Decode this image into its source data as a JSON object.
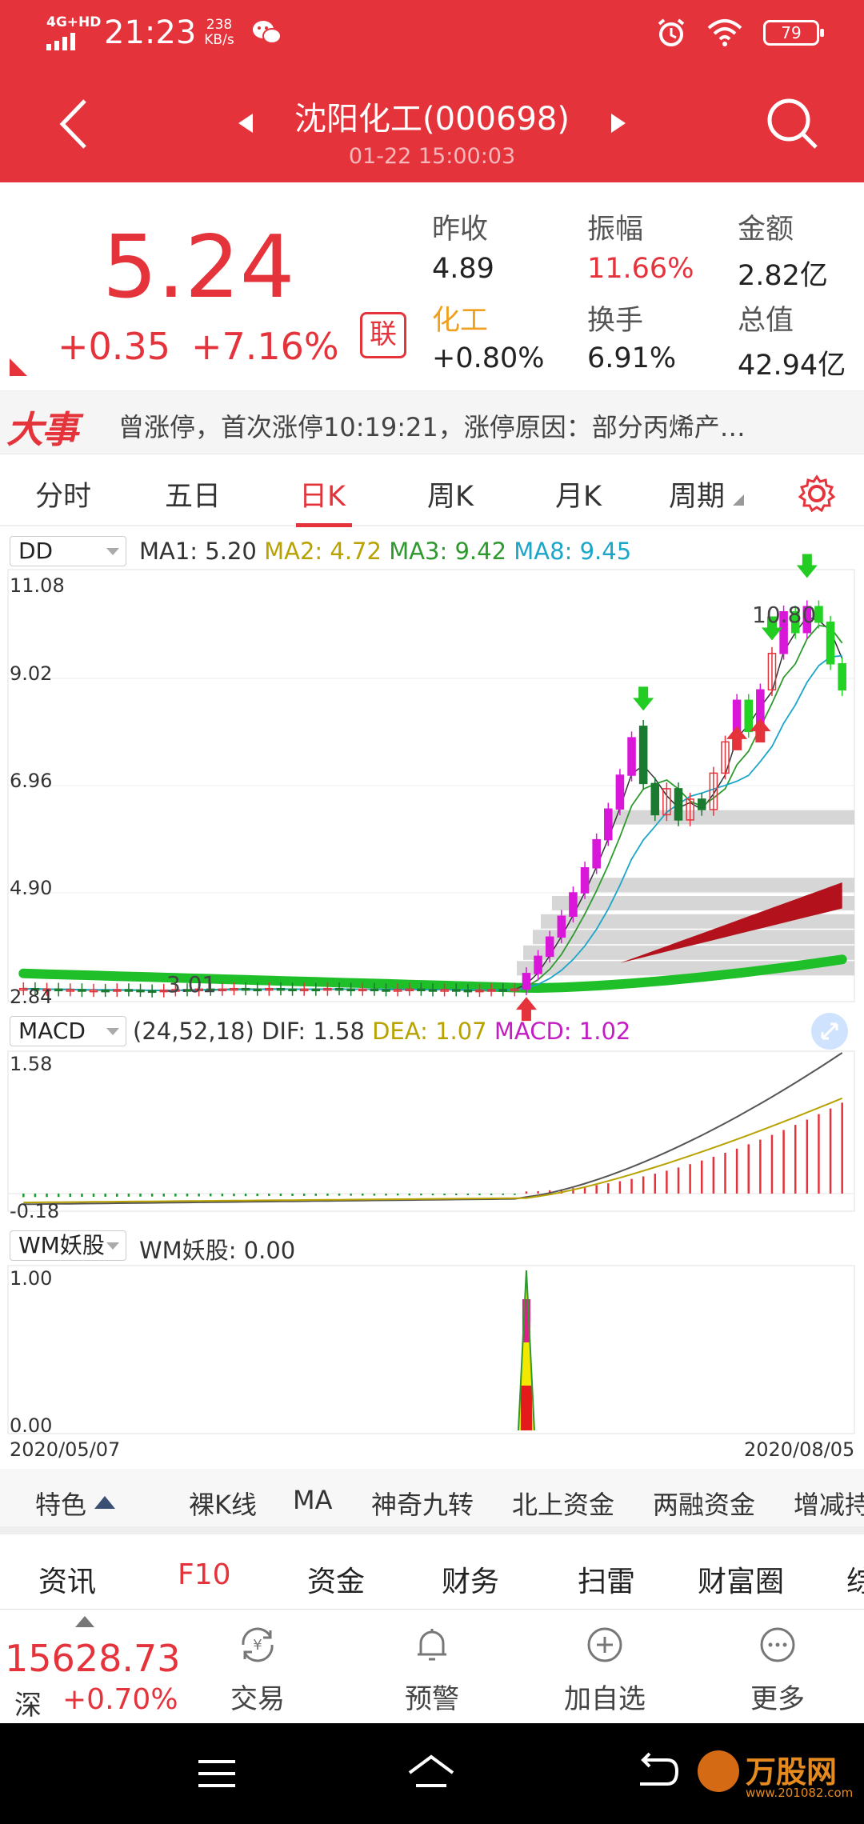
{
  "status_bar": {
    "network": "4G+HD",
    "time": "21:23",
    "speed_value": "238",
    "speed_unit": "KB/s",
    "battery": "79"
  },
  "header": {
    "stock_name": "沈阳化工(000698)",
    "timestamp": "01-22 15:00:03"
  },
  "quote": {
    "price": "5.24",
    "change": "+0.35",
    "change_pct": "+7.16%",
    "lian_label": "联",
    "prev_close_label": "昨收",
    "prev_close": "4.89",
    "amplitude_label": "振幅",
    "amplitude": "11.66%",
    "amount_label": "金额",
    "amount": "2.82亿",
    "sector_label": "化工",
    "sector_change": "+0.80%",
    "turnover_label": "换手",
    "turnover": "6.91%",
    "market_cap_label": "总值",
    "market_cap": "42.94亿"
  },
  "news": {
    "logo": "大事",
    "text": "曾涨停，首次涨停10:19:21，涨停原因：部分丙烯产…"
  },
  "period_tabs": [
    {
      "label": "分时"
    },
    {
      "label": "五日"
    },
    {
      "label": "日K"
    },
    {
      "label": "周K"
    },
    {
      "label": "月K"
    },
    {
      "label": "周期"
    }
  ],
  "kline": {
    "indicator": "DD",
    "ma1": "MA1: 5.20",
    "ma2": "MA2: 4.72",
    "ma3": "MA3: 9.42",
    "ma8": "MA8: 9.45",
    "y_max": "11.08",
    "y_2": "9.02",
    "y_3": "6.96",
    "y_4": "4.90",
    "y_min": "2.84",
    "low_mark": "3.01",
    "high_mark": "10.80"
  },
  "macd": {
    "indicator": "MACD",
    "params": "(24,52,18)",
    "dif": "DIF: 1.58",
    "dea": "DEA: 1.07",
    "macd": "MACD: 1.02",
    "y_max": "1.58",
    "y_min": "-0.18"
  },
  "wm": {
    "indicator": "WM妖股",
    "value": "WM妖股: 0.00",
    "y_max": "1.00",
    "y_min": "0.00",
    "date_start": "2020/05/07",
    "date_end": "2020/08/05"
  },
  "indicator_tabs": [
    "特色",
    "裸K线",
    "MA",
    "神奇九转",
    "北上资金",
    "两融资金",
    "增减持"
  ],
  "secondary_tabs": [
    "资讯",
    "F10",
    "资金",
    "财务",
    "扫雷",
    "财富圈",
    "综"
  ],
  "bottom": {
    "index_value": "15628.73",
    "index_name": "深",
    "index_change": "+0.70%",
    "trade": "交易",
    "alert": "预警",
    "add_watch": "加自选",
    "more": "更多"
  },
  "watermark": {
    "text": "万股网",
    "url": "www.201082.com"
  },
  "colors": {
    "brand_red": "#e5333c",
    "ma1": "#333333",
    "ma2": "#b8a200",
    "ma3": "#2e9a2e",
    "ma8": "#1aa6c9",
    "macd_bar": "#e5333c"
  },
  "chart_data": [
    {
      "type": "candlestick",
      "title": "",
      "ylim": [
        2.84,
        11.08
      ],
      "series": [
        {
          "name": "MA1",
          "values": [
            5.2
          ]
        },
        {
          "name": "MA2",
          "values": [
            4.72
          ]
        },
        {
          "name": "MA3",
          "values": [
            9.42
          ]
        },
        {
          "name": "MA8",
          "values": [
            9.45
          ]
        }
      ],
      "candles": [
        {
          "o": 3.05,
          "c": 3.06
        },
        {
          "o": 3.06,
          "c": 3.04
        },
        {
          "o": 3.04,
          "c": 3.05
        },
        {
          "o": 3.05,
          "c": 3.03
        },
        {
          "o": 3.03,
          "c": 3.04
        },
        {
          "o": 3.04,
          "c": 3.02
        },
        {
          "o": 3.02,
          "c": 3.03
        },
        {
          "o": 3.03,
          "c": 3.02
        },
        {
          "o": 3.02,
          "c": 3.04
        },
        {
          "o": 3.04,
          "c": 3.03
        },
        {
          "o": 3.03,
          "c": 3.02
        },
        {
          "o": 3.02,
          "c": 3.01
        },
        {
          "o": 3.01,
          "c": 3.03
        },
        {
          "o": 3.03,
          "c": 3.04
        },
        {
          "o": 3.04,
          "c": 3.03
        },
        {
          "o": 3.03,
          "c": 3.05
        },
        {
          "o": 3.05,
          "c": 3.04
        },
        {
          "o": 3.04,
          "c": 3.05
        },
        {
          "o": 3.05,
          "c": 3.06
        },
        {
          "o": 3.06,
          "c": 3.05
        },
        {
          "o": 3.05,
          "c": 3.04
        },
        {
          "o": 3.04,
          "c": 3.06
        },
        {
          "o": 3.06,
          "c": 3.05
        },
        {
          "o": 3.05,
          "c": 3.04
        },
        {
          "o": 3.04,
          "c": 3.05
        },
        {
          "o": 3.05,
          "c": 3.04
        },
        {
          "o": 3.04,
          "c": 3.06
        },
        {
          "o": 3.06,
          "c": 3.05
        },
        {
          "o": 3.05,
          "c": 3.04
        },
        {
          "o": 3.04,
          "c": 3.05
        },
        {
          "o": 3.05,
          "c": 3.04
        },
        {
          "o": 3.04,
          "c": 3.03
        },
        {
          "o": 3.03,
          "c": 3.04
        },
        {
          "o": 3.04,
          "c": 3.05
        },
        {
          "o": 3.05,
          "c": 3.04
        },
        {
          "o": 3.04,
          "c": 3.03
        },
        {
          "o": 3.03,
          "c": 3.04
        },
        {
          "o": 3.04,
          "c": 3.03
        },
        {
          "o": 3.03,
          "c": 3.02
        },
        {
          "o": 3.02,
          "c": 3.03
        },
        {
          "o": 3.03,
          "c": 3.04
        },
        {
          "o": 3.04,
          "c": 3.03
        },
        {
          "o": 3.03,
          "c": 3.05
        },
        {
          "o": 3.05,
          "c": 3.35
        },
        {
          "o": 3.35,
          "c": 3.68
        },
        {
          "o": 3.68,
          "c": 4.05
        },
        {
          "o": 4.05,
          "c": 4.45
        },
        {
          "o": 4.45,
          "c": 4.9
        },
        {
          "o": 4.9,
          "c": 5.38
        },
        {
          "o": 5.38,
          "c": 5.92
        },
        {
          "o": 5.92,
          "c": 6.51
        },
        {
          "o": 6.51,
          "c": 7.16
        },
        {
          "o": 7.16,
          "c": 7.88
        },
        {
          "o": 8.1,
          "c": 7.0
        },
        {
          "o": 7.0,
          "c": 6.4
        },
        {
          "o": 6.4,
          "c": 6.9
        },
        {
          "o": 6.9,
          "c": 6.3
        },
        {
          "o": 6.3,
          "c": 6.7
        },
        {
          "o": 6.7,
          "c": 6.5
        },
        {
          "o": 6.5,
          "c": 7.2
        },
        {
          "o": 7.2,
          "c": 7.8
        },
        {
          "o": 7.8,
          "c": 8.6
        },
        {
          "o": 8.6,
          "c": 8.0
        },
        {
          "o": 8.0,
          "c": 8.8
        },
        {
          "o": 8.8,
          "c": 9.5
        },
        {
          "o": 9.5,
          "c": 10.3
        },
        {
          "o": 10.3,
          "c": 9.9
        },
        {
          "o": 9.9,
          "c": 10.4
        },
        {
          "o": 10.4,
          "c": 10.1
        },
        {
          "o": 10.1,
          "c": 9.3
        },
        {
          "o": 9.3,
          "c": 8.8
        }
      ]
    },
    {
      "type": "bar",
      "title": "",
      "ylim": [
        -0.18,
        1.58
      ],
      "series": [
        {
          "name": "DIF",
          "values": [
            1.58
          ]
        },
        {
          "name": "DEA",
          "values": [
            1.07
          ]
        },
        {
          "name": "MACD",
          "values": [
            1.02
          ]
        }
      ]
    },
    {
      "type": "line",
      "title": "",
      "ylim": [
        0.0,
        1.0
      ],
      "x": [
        "2020/05/07",
        "2020/08/05"
      ],
      "series": [
        {
          "name": "WM妖股",
          "values": [
            0.0
          ]
        }
      ]
    }
  ]
}
